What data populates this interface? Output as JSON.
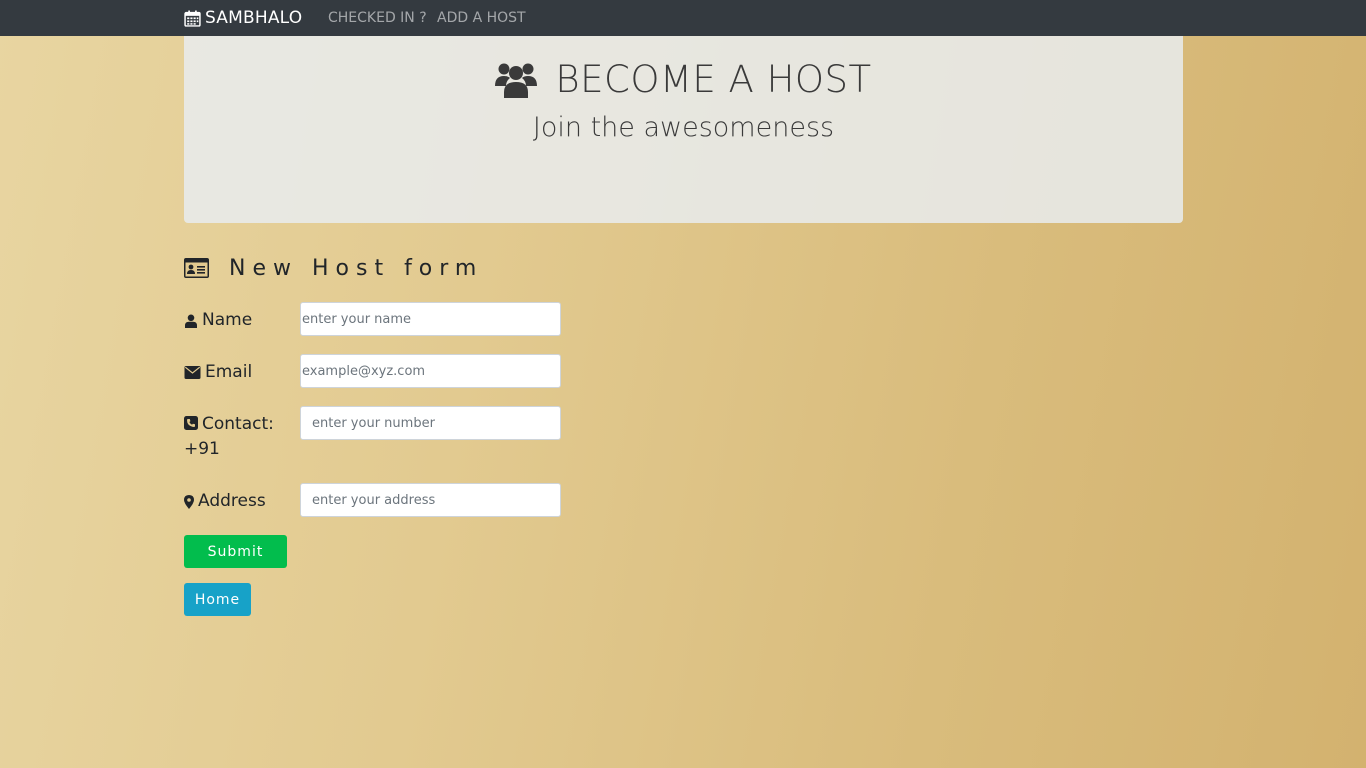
{
  "navbar": {
    "brand": "SAMBHALO",
    "brand_icon": "calendar-icon",
    "links": [
      "CHECKED IN ?",
      "ADD A HOST"
    ]
  },
  "jumbotron": {
    "icon": "users-icon",
    "title": "BECOME A HOST",
    "subtitle": "Join the awesomeness"
  },
  "form": {
    "icon": "id-card-icon",
    "heading": "New Host form",
    "fields": {
      "name": {
        "icon": "user-icon",
        "label": "Name",
        "placeholder": "enter your name",
        "value": ""
      },
      "email": {
        "icon": "envelope-icon",
        "label": "Email",
        "placeholder": "example@xyz.com",
        "value": ""
      },
      "contact": {
        "icon": "phone-icon",
        "label": "Contact:",
        "prefix": "+91",
        "placeholder": "enter your number",
        "value": ""
      },
      "address": {
        "icon": "map-marker-icon",
        "label": "Address",
        "placeholder": "enter your address",
        "value": ""
      }
    },
    "submit_label": "Submit",
    "home_label": "Home"
  },
  "colors": {
    "navbar": "#343a40",
    "submit": "#02bd4d",
    "home": "#17a2c8"
  }
}
